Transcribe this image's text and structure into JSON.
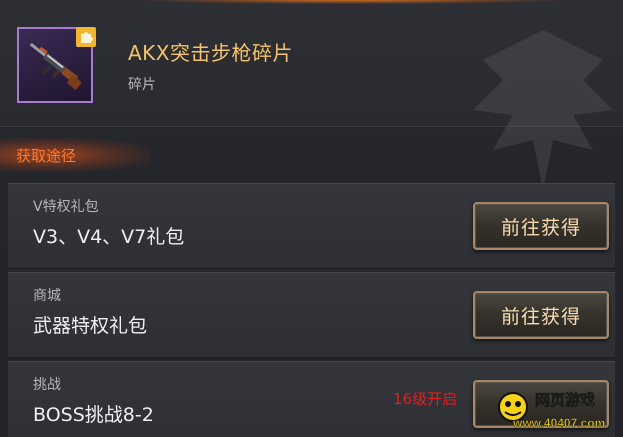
{
  "item": {
    "name": "AKX突击步枪碎片",
    "type": "碎片",
    "icon": "assault-rifle-icon",
    "badge_icon": "puzzle-piece-icon",
    "frame_color": "#a77bd0"
  },
  "section": {
    "title": "获取途径"
  },
  "sources": [
    {
      "label": "V特权礼包",
      "name": "V3、V4、V7礼包",
      "button": "前往获得"
    },
    {
      "label": "商城",
      "name": "武器特权礼包",
      "button": "前往获得"
    },
    {
      "label": "挑战",
      "name": "BOSS挑战8-2",
      "note": "16级开启"
    }
  ],
  "watermark": {
    "line1": "网页游戏",
    "line2": "www.40407.com"
  },
  "colors": {
    "accent": "#ff7a2c",
    "title": "#f5c36b",
    "locked": "#e21f1f"
  }
}
